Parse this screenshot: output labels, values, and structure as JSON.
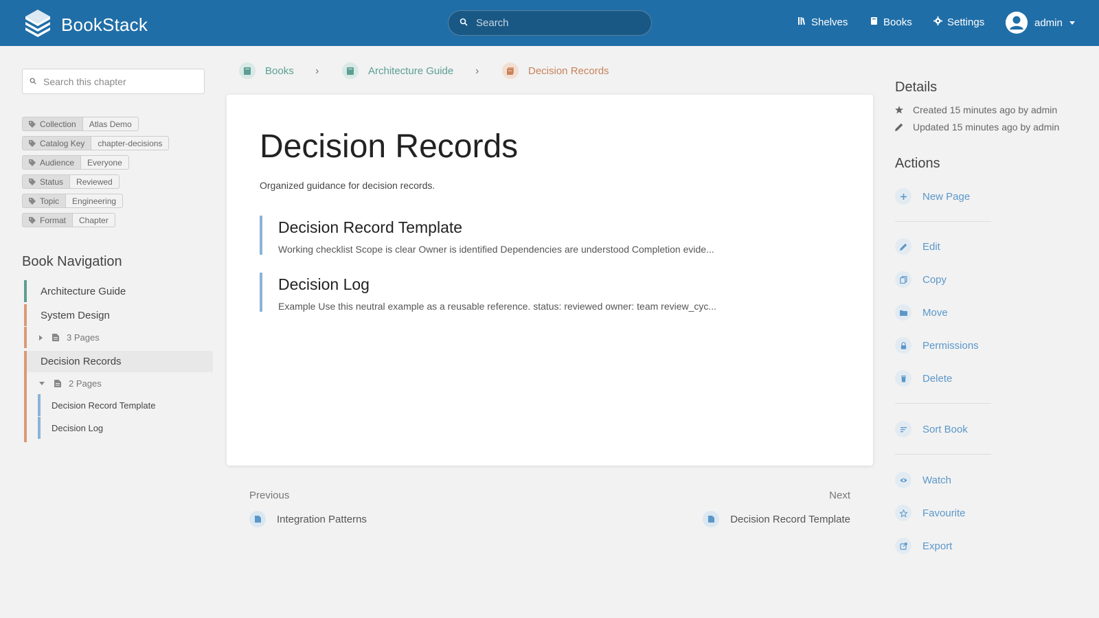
{
  "header": {
    "brand": "BookStack",
    "search_placeholder": "Search",
    "nav": {
      "shelves": "Shelves",
      "books": "Books",
      "settings": "Settings"
    },
    "user": "admin"
  },
  "sidebar": {
    "search_placeholder": "Search this chapter",
    "tags": [
      {
        "name": "Collection",
        "value": "Atlas Demo"
      },
      {
        "name": "Catalog Key",
        "value": "chapter-decisions"
      },
      {
        "name": "Audience",
        "value": "Everyone"
      },
      {
        "name": "Status",
        "value": "Reviewed"
      },
      {
        "name": "Topic",
        "value": "Engineering"
      },
      {
        "name": "Format",
        "value": "Chapter"
      }
    ],
    "book_nav_title": "Book Navigation",
    "book": "Architecture Guide",
    "chapters": [
      {
        "label": "System Design",
        "pages_label": "3 Pages"
      },
      {
        "label": "Decision Records",
        "pages_label": "2 Pages"
      }
    ],
    "pages": [
      "Decision Record Template",
      "Decision Log"
    ]
  },
  "breadcrumb": {
    "books": "Books",
    "book": "Architecture Guide",
    "chapter": "Decision Records"
  },
  "main": {
    "title": "Decision Records",
    "description": "Organized guidance for decision records.",
    "entities": [
      {
        "title": "Decision Record Template",
        "excerpt": "Working checklist Scope is clear Owner is identified Dependencies are understood Completion evide..."
      },
      {
        "title": "Decision Log",
        "excerpt": "Example Use this neutral example as a reusable reference. status: reviewed owner: team review_cyc..."
      }
    ]
  },
  "prevnext": {
    "previous_label": "Previous",
    "previous_page": "Integration Patterns",
    "next_label": "Next",
    "next_page": "Decision Record Template"
  },
  "details": {
    "title": "Details",
    "created": "Created 15 minutes ago by admin",
    "updated": "Updated 15 minutes ago by admin"
  },
  "actions": {
    "title": "Actions",
    "new_page": "New Page",
    "edit": "Edit",
    "copy": "Copy",
    "move": "Move",
    "permissions": "Permissions",
    "delete": "Delete",
    "sort_book": "Sort Book",
    "watch": "Watch",
    "favourite": "Favourite",
    "export": "Export"
  },
  "colors": {
    "header": "#206ea7",
    "book": "#5c9e93",
    "chapter": "#d99a78",
    "page": "#8bb3d6",
    "link": "#5b97c9"
  },
  "icons": [
    "books-logo-icon",
    "search-icon",
    "shelves-icon",
    "books-icon",
    "gear-icon",
    "user-avatar-icon",
    "tag-icon",
    "page-icon",
    "book-icon",
    "chapter-icon",
    "star-icon",
    "pencil-icon",
    "plus-icon",
    "copy-icon",
    "folder-icon",
    "lock-icon",
    "trash-icon",
    "sort-icon",
    "eye-icon",
    "export-icon"
  ]
}
